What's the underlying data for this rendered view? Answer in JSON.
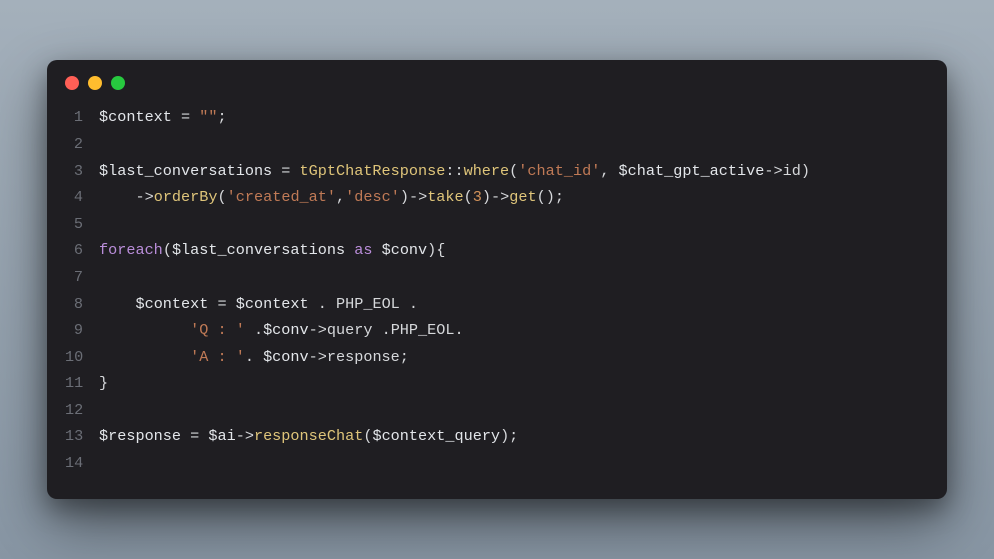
{
  "window": {
    "traffic_lights": [
      "close",
      "minimize",
      "zoom"
    ]
  },
  "editor": {
    "lines": [
      {
        "n": "1",
        "segments": [
          {
            "t": "$context",
            "c": "var"
          },
          {
            "t": " = ",
            "c": "op"
          },
          {
            "t": "\"\"",
            "c": "str"
          },
          {
            "t": ";",
            "c": "punc"
          }
        ]
      },
      {
        "n": "2",
        "segments": []
      },
      {
        "n": "3",
        "segments": [
          {
            "t": "$last_conversations",
            "c": "var"
          },
          {
            "t": " = ",
            "c": "op"
          },
          {
            "t": "tGptChatResponse",
            "c": "class"
          },
          {
            "t": "::",
            "c": "op"
          },
          {
            "t": "where",
            "c": "call"
          },
          {
            "t": "(",
            "c": "punc"
          },
          {
            "t": "'chat_id'",
            "c": "str"
          },
          {
            "t": ", ",
            "c": "punc"
          },
          {
            "t": "$chat_gpt_active",
            "c": "var"
          },
          {
            "t": "->",
            "c": "arrow"
          },
          {
            "t": "id",
            "c": "prop"
          },
          {
            "t": ")",
            "c": "punc"
          }
        ]
      },
      {
        "n": "4",
        "segments": [
          {
            "t": "    ",
            "c": "punc"
          },
          {
            "t": "->",
            "c": "arrow"
          },
          {
            "t": "orderBy",
            "c": "call"
          },
          {
            "t": "(",
            "c": "punc"
          },
          {
            "t": "'created_at'",
            "c": "str"
          },
          {
            "t": ",",
            "c": "punc"
          },
          {
            "t": "'desc'",
            "c": "str"
          },
          {
            "t": ")",
            "c": "punc"
          },
          {
            "t": "->",
            "c": "arrow"
          },
          {
            "t": "take",
            "c": "call"
          },
          {
            "t": "(",
            "c": "punc"
          },
          {
            "t": "3",
            "c": "num"
          },
          {
            "t": ")",
            "c": "punc"
          },
          {
            "t": "->",
            "c": "arrow"
          },
          {
            "t": "get",
            "c": "call"
          },
          {
            "t": "();",
            "c": "punc"
          }
        ]
      },
      {
        "n": "5",
        "segments": []
      },
      {
        "n": "6",
        "segments": [
          {
            "t": "foreach",
            "c": "kw"
          },
          {
            "t": "(",
            "c": "punc"
          },
          {
            "t": "$last_conversations",
            "c": "var"
          },
          {
            "t": " ",
            "c": "punc"
          },
          {
            "t": "as",
            "c": "kw"
          },
          {
            "t": " ",
            "c": "punc"
          },
          {
            "t": "$conv",
            "c": "var"
          },
          {
            "t": "){",
            "c": "punc"
          }
        ]
      },
      {
        "n": "7",
        "segments": []
      },
      {
        "n": "8",
        "segments": [
          {
            "t": "    ",
            "c": "punc"
          },
          {
            "t": "$context",
            "c": "var"
          },
          {
            "t": " = ",
            "c": "op"
          },
          {
            "t": "$context",
            "c": "var"
          },
          {
            "t": " . ",
            "c": "op"
          },
          {
            "t": "PHP_EOL",
            "c": "const"
          },
          {
            "t": " .",
            "c": "op"
          }
        ]
      },
      {
        "n": "9",
        "segments": [
          {
            "t": "          ",
            "c": "punc"
          },
          {
            "t": "'Q : '",
            "c": "str"
          },
          {
            "t": " .",
            "c": "op"
          },
          {
            "t": "$conv",
            "c": "var"
          },
          {
            "t": "->",
            "c": "arrow"
          },
          {
            "t": "query",
            "c": "prop"
          },
          {
            "t": " .",
            "c": "op"
          },
          {
            "t": "PHP_EOL",
            "c": "const"
          },
          {
            "t": ".",
            "c": "op"
          }
        ]
      },
      {
        "n": "10",
        "segments": [
          {
            "t": "          ",
            "c": "punc"
          },
          {
            "t": "'A : '",
            "c": "str"
          },
          {
            "t": ". ",
            "c": "op"
          },
          {
            "t": "$conv",
            "c": "var"
          },
          {
            "t": "->",
            "c": "arrow"
          },
          {
            "t": "response",
            "c": "prop"
          },
          {
            "t": ";",
            "c": "punc"
          }
        ]
      },
      {
        "n": "11",
        "segments": [
          {
            "t": "}",
            "c": "punc"
          }
        ]
      },
      {
        "n": "12",
        "segments": []
      },
      {
        "n": "13",
        "segments": [
          {
            "t": "$response",
            "c": "var"
          },
          {
            "t": " = ",
            "c": "op"
          },
          {
            "t": "$ai",
            "c": "var"
          },
          {
            "t": "->",
            "c": "arrow"
          },
          {
            "t": "responseChat",
            "c": "call"
          },
          {
            "t": "(",
            "c": "punc"
          },
          {
            "t": "$context_query",
            "c": "var"
          },
          {
            "t": ");",
            "c": "punc"
          }
        ]
      },
      {
        "n": "14",
        "segments": []
      }
    ]
  }
}
